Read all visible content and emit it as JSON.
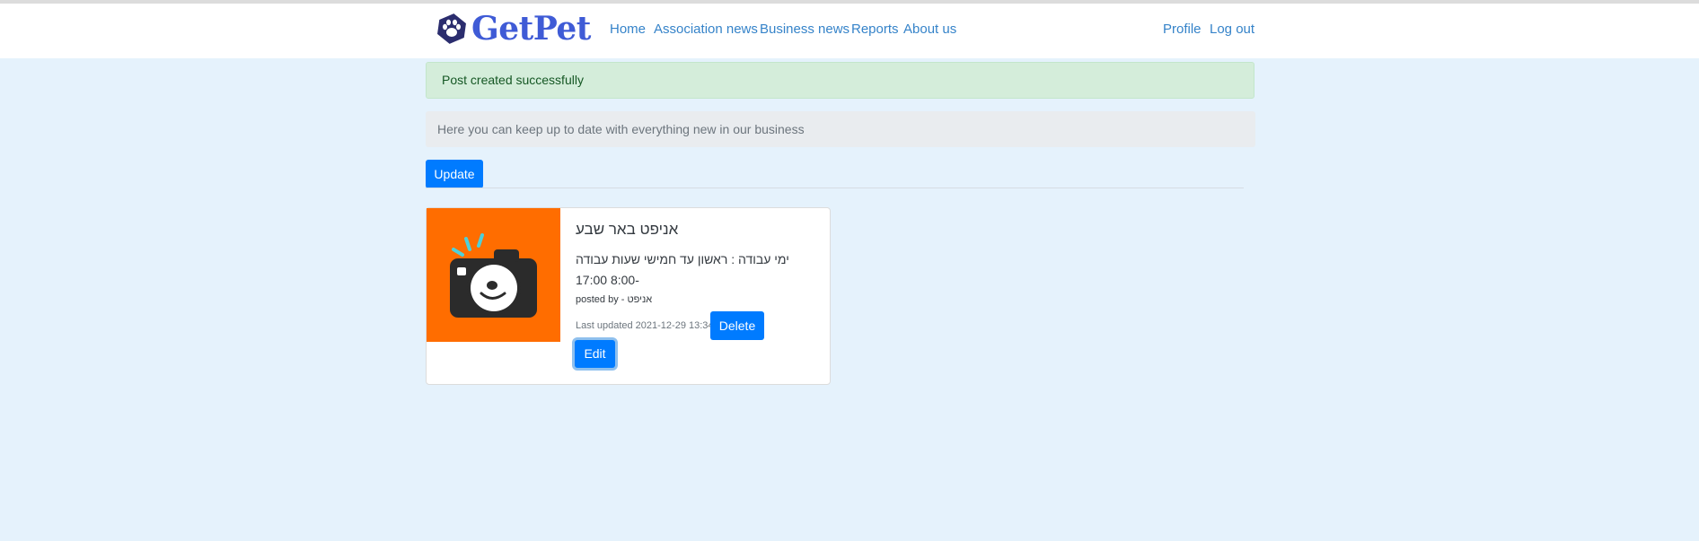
{
  "brand": {
    "name": "GetPet",
    "logo_icon": "paw-icon",
    "color": "#3f5bd6",
    "badge_color": "#2b2d6e"
  },
  "nav": {
    "left": [
      "Home",
      "Association news",
      "Business news",
      "Reports",
      "About us"
    ],
    "right": [
      "Profile",
      "Log out"
    ]
  },
  "alert": {
    "text": "Post created successfully"
  },
  "info": {
    "text": "Here you can keep up to date with everything new in our business"
  },
  "toolbar": {
    "update_label": "Update"
  },
  "post": {
    "image_icon": "camera-dog-icon",
    "image_bg": "#ff6d00",
    "title": "אניפט באר שבע",
    "body": "ימי עבודה : ראשון עד חמישי שעות עבודה -8:00 17:00",
    "posted_by": "posted by - אניפט",
    "last_updated": "Last updated 2021-12-29 13:34",
    "delete_label": "Delete",
    "edit_label": "Edit"
  },
  "colors": {
    "primary": "#007bff",
    "page_bg": "#e5f2fc",
    "link": "#3583c9"
  }
}
